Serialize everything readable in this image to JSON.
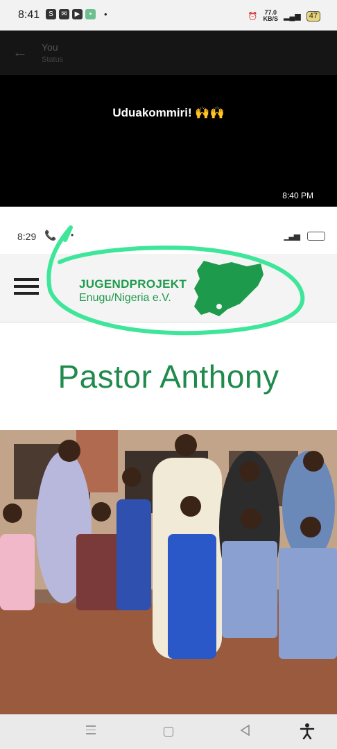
{
  "status_bar": {
    "time": "8:41",
    "app_icons": [
      "S",
      "messenger-icon",
      "youtube-icon",
      "app-icon"
    ],
    "network_speed": "77.0",
    "network_unit": "KB/S",
    "battery": "47"
  },
  "chat_bar": {
    "title": "You",
    "subtitle": "Status"
  },
  "message": {
    "text": "Uduakommiri! 🙌🙌",
    "time": "8:40 PM"
  },
  "screenshot": {
    "inner_status": {
      "time": "8:29"
    },
    "site": {
      "logo_line1": "JUGENDPROJEKT",
      "logo_line2": "Enugu/Nigeria e.V.",
      "headline": "Pastor Anthony"
    },
    "colors": {
      "brand_green": "#1d9a4b",
      "highlight": "#3ee69a"
    }
  },
  "nav_bar": {
    "items": [
      "menu-icon",
      "home-icon",
      "back-icon",
      "accessibility-icon"
    ]
  }
}
